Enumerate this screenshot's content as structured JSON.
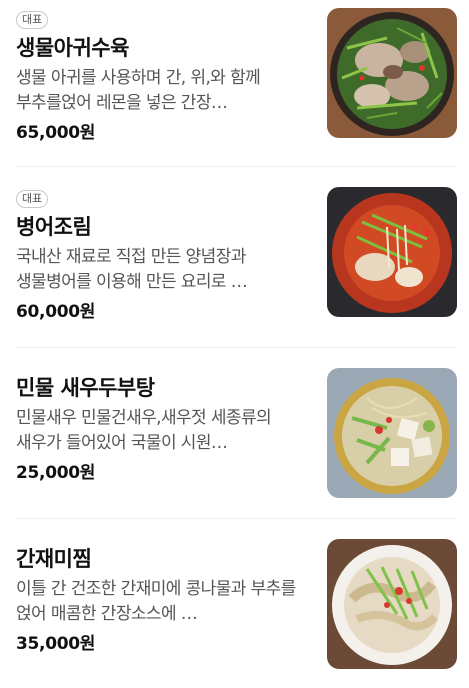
{
  "menu": {
    "items": [
      {
        "badge": "대표",
        "name": "생물아귀수육",
        "description": "생물 아귀를 사용하며 간, 위,와 함께 부추를얹어 레몬을 넣은 간장…",
        "price": "65,000원",
        "photo": "boiled-monkfish-photo"
      },
      {
        "badge": "대표",
        "name": "병어조림",
        "description": "국내산 재료로 직접 만든 양념장과 생물병어를 이용해 만든 요리로 …",
        "price": "60,000원",
        "photo": "braised-pomfret-photo"
      },
      {
        "badge": "",
        "name": "민물 새우두부탕",
        "description": "민물새우 민물건새우,새우젓 세종류의 새우가 들어있어 국물이 시원…",
        "price": "25,000원",
        "photo": "shrimp-tofu-soup-photo"
      },
      {
        "badge": "",
        "name": "간재미찜",
        "description": "이틀 간 건조한 간재미에 콩나물과 부추를 얹어 매콤한 간장소스에 …",
        "price": "35,000원",
        "photo": "steamed-skate-photo"
      }
    ]
  }
}
